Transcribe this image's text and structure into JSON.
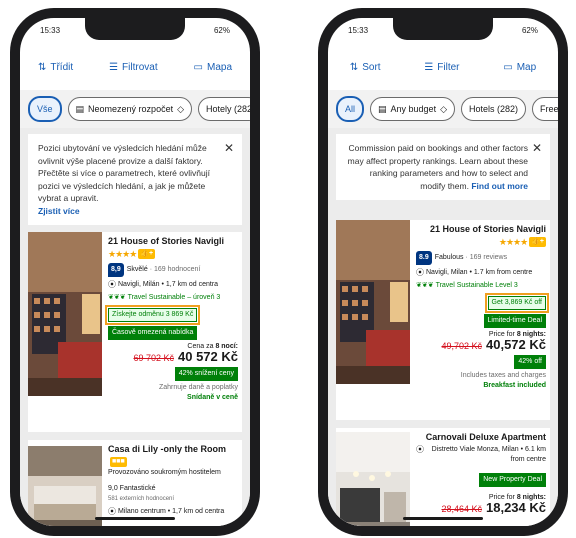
{
  "phones": [
    {
      "lang": "cs",
      "status": {
        "time": "15:33",
        "battery": "62%"
      },
      "toolbar": {
        "sort": "Třídit",
        "filter": "Filtrovat",
        "map": "Mapa"
      },
      "chips": {
        "all": "Vše",
        "budget": "Neomezený rozpočet",
        "hotels": "Hotely (282"
      },
      "info": {
        "text": "Pozici ubytování ve výsledcích hledání může ovlivnit výše placené provize a další faktory. Přečtěte si více o parametrech, které ovlivňují pozici ve výsledcích hledání, a jak je můžete vybrat a upravit.",
        "link": "Zjistit více"
      },
      "hotel1": {
        "name": "21 House of Stories Navigli",
        "score": "8,9",
        "score_word": "Skvělé",
        "reviews": "169 hodnocení",
        "location": "Navigli, Milán • 1,7 km od centra",
        "sustainable": "Travel Sustainable – úroveň 3",
        "deal": "Získejte odměnu 3 869 Kč",
        "limited": "Časově omezená nabídka",
        "price_for_prefix": "Cena za",
        "price_for_nights": "8 nocí:",
        "old_price": "69 702 Kč",
        "price": "40 572 Kč",
        "discount": "42% snížení ceny",
        "taxes": "Zahrnuje daně a poplatky",
        "breakfast": "Snídaně v ceně"
      },
      "hotel2": {
        "name": "Casa di Lily -only the Room",
        "host": "Provozováno soukromým hostitelem",
        "score_line": "9,0 Fantastické",
        "reviews": "581 externích hodnocení",
        "location": "Milano centrum • 1,7 km od centra"
      }
    },
    {
      "lang": "en",
      "status": {
        "time": "15:33",
        "battery": "62%"
      },
      "toolbar": {
        "sort": "Sort",
        "filter": "Filter",
        "map": "Map"
      },
      "chips": {
        "all": "All",
        "budget": "Any budget",
        "hotels": "Hotels (282)",
        "free": "Free c"
      },
      "info": {
        "text": "Commission paid on bookings and other factors may affect property rankings. Learn about these ranking parameters and how to select and modify them.",
        "link": "Find out more"
      },
      "hotel1": {
        "name": "21 House of Stories Navigli",
        "score": "8.9",
        "score_word": "Fabulous",
        "reviews": "169 reviews",
        "location": "Navigli, Milan • 1.7 km from centre",
        "sustainable": "Travel Sustainable Level 3",
        "deal": "Get 3,869 Kč off",
        "limited": "Limited-time Deal",
        "price_for_prefix": "Price for",
        "price_for_nights": "8 nights:",
        "old_price": "49,702 Kč",
        "price": "40,572 Kč",
        "discount": "42% off",
        "taxes": "Includes taxes and charges",
        "breakfast": "Breakfast included"
      },
      "hotel2": {
        "name": "Carnovali Deluxe Apartment",
        "location": "Distretto Viale Monza, Milan • 6.1 km from centre",
        "new_deal": "New Property Deal",
        "price_for_prefix": "Price for",
        "price_for_nights": "8 nights:",
        "old_price": "28,464 Kč",
        "price": "18,234 Kč"
      }
    }
  ],
  "colors": {
    "brand_blue": "#1a5fb4",
    "navy": "#003580",
    "green": "#008009",
    "red_strike": "#d4111e",
    "highlight": "#f0a020"
  }
}
